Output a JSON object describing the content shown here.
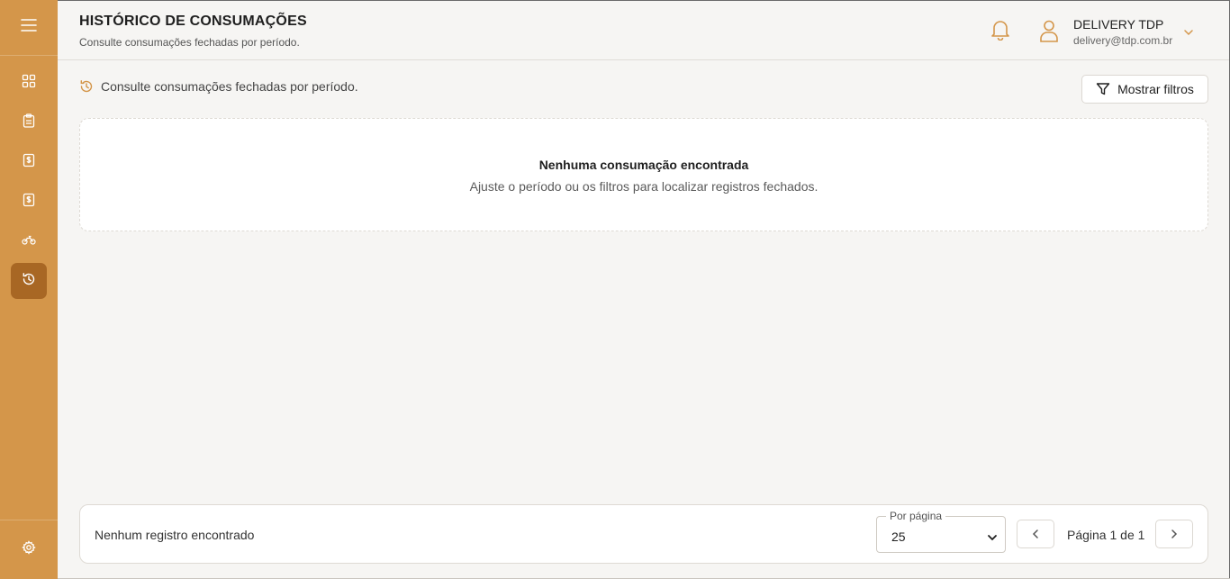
{
  "sidebar": {
    "menu_icon": "hamburger-menu-icon",
    "items": [
      {
        "icon": "dashboard-grid-icon",
        "active": false
      },
      {
        "icon": "clipboard-icon",
        "active": false
      },
      {
        "icon": "receipt-dollar-icon",
        "active": false
      },
      {
        "icon": "invoice-dollar-icon",
        "active": false
      },
      {
        "icon": "motorcycle-icon",
        "active": false
      },
      {
        "icon": "history-icon",
        "active": true
      }
    ],
    "settings_icon": "gear-icon"
  },
  "header": {
    "title": "HISTÓRICO DE CONSUMAÇÕES",
    "subtitle": "Consulte consumações fechadas por período.",
    "user": {
      "name": "DELIVERY TDP",
      "email": "delivery@tdp.com.br"
    }
  },
  "content": {
    "description": "Consulte consumações fechadas por período.",
    "filter_button": "Mostrar filtros",
    "empty_state": {
      "title": "Nenhuma consumação encontrada",
      "message": "Ajuste o período ou os filtros para localizar registros fechados."
    }
  },
  "footer": {
    "records_text": "Nenhum registro encontrado",
    "per_page_label": "Por página",
    "per_page_value": "25",
    "page_info": "Página 1 de 1"
  },
  "colors": {
    "sidebar": "#d4964a",
    "sidebar_active": "#a86724",
    "accent": "#d4964a"
  }
}
